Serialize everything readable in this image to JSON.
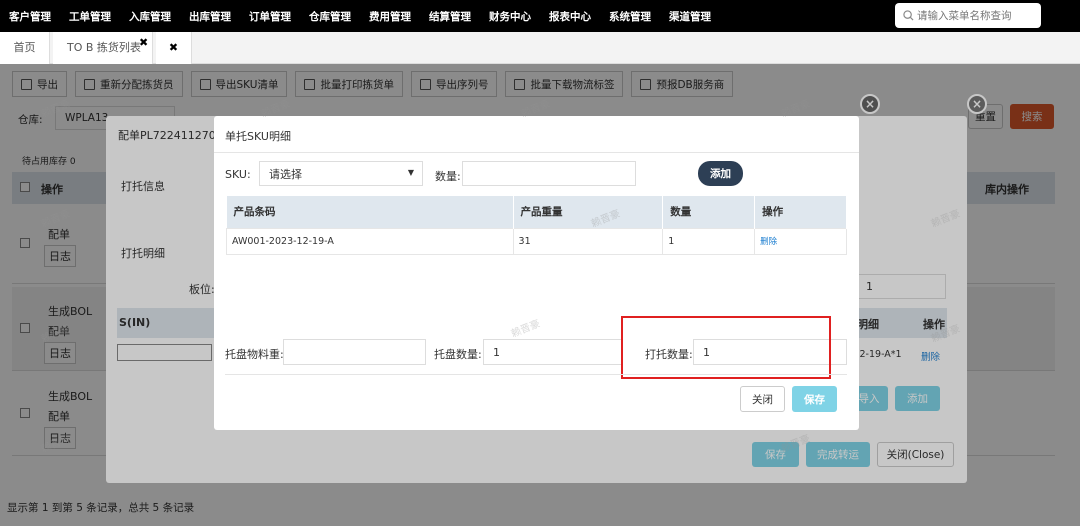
{
  "nav": {
    "items": [
      "客户管理",
      "工单管理",
      "入库管理",
      "出库管理",
      "订单管理",
      "仓库管理",
      "费用管理",
      "结算管理",
      "财务中心",
      "报表中心",
      "系统管理",
      "渠道管理"
    ],
    "search_placeholder": "请输入菜单名称查询"
  },
  "tabs": {
    "home": "首页",
    "active": "TO B 拣货列表"
  },
  "toolbar": [
    "导出",
    "重新分配拣货员",
    "导出SKU清单",
    "批量打印拣货单",
    "导出序列号",
    "批量下载物流标签",
    "预报DB服务商"
  ],
  "background": {
    "warehouse_label": "仓库:",
    "warehouse_value": "WPLA13",
    "search_btn": "搜索",
    "reset_btn": "重置",
    "pending_stock": "待占用库存 0",
    "col_ops": "操作",
    "col_inner": "库内操作",
    "rows": [
      {
        "ops": [
          "配单",
          "日志"
        ]
      },
      {
        "ops": [
          "生成BOL",
          "配单",
          "日志"
        ]
      },
      {
        "ops": [
          "生成BOL",
          "配单",
          "日志"
        ]
      }
    ],
    "pager": "显示第 1 到第 5 条记录，总共 5 条记录"
  },
  "dialog1": {
    "title": "配单PL72241127006",
    "print_info": "打托信息",
    "print_detail": "打托明细",
    "board_label": "板位:",
    "board_value": "1",
    "col_in": "S(IN)",
    "col_detail": "明细",
    "col_op": "操作",
    "detail_code": "3-12-19-A*1",
    "delete": "删除",
    "import_btn": "导入",
    "add_btn": "添加",
    "save_btn": "保存",
    "complete_btn": "完成转运",
    "close_btn": "关闭(Close)"
  },
  "dialog2": {
    "title": "单托SKU明细",
    "sku_label": "SKU:",
    "sku_placeholder": "请选择",
    "qty_label": "数量:",
    "add_btn": "添加",
    "table": {
      "headers": [
        "产品条码",
        "产品重量",
        "数量",
        "操作"
      ],
      "rows": [
        [
          "AW001-2023-12-19-A",
          "31",
          "1",
          "删除"
        ]
      ]
    },
    "pallet_weight_label": "托盘物料重:",
    "pallet_count_label": "托盘数量:",
    "pallet_count_value": "1",
    "print_count_label": "打托数量:",
    "print_count_value": "1",
    "close_btn": "关闭",
    "save_btn": "保存"
  },
  "watermark": "赖晋豪",
  "colors": {
    "accent_btn": "#2d3f55",
    "save_btn": "#7fd3e6",
    "search_btn": "#e05a2c",
    "highlight": "#e02020"
  }
}
